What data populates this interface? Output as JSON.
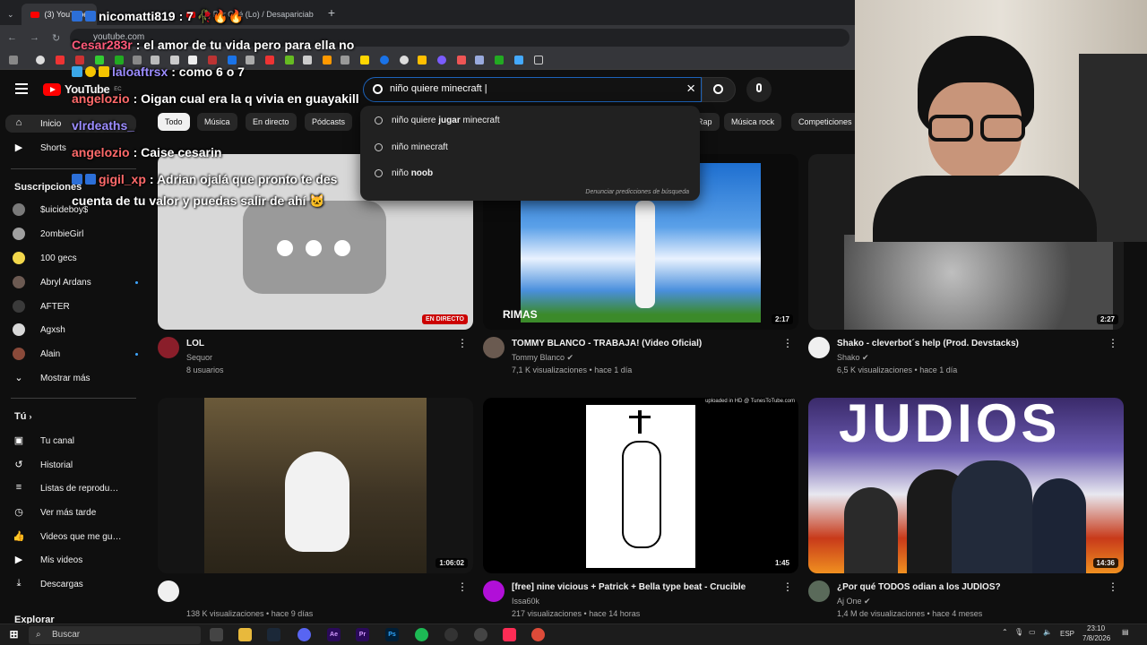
{
  "browser": {
    "tabs": [
      {
        "title": "(3) YouTube"
      },
      {
        "title": "(3) Por Qué (Lo) / Desapariciab"
      }
    ],
    "new_tab": "+",
    "url": "youtube.com"
  },
  "youtube": {
    "logo": "YouTube",
    "logo_region": "EC",
    "search_value": "niño quiere minecraft |",
    "clear_icon": "×",
    "suggestions": [
      {
        "prefix": "niño quiere ",
        "bold": "jugar",
        "suffix": " minecraft"
      },
      {
        "prefix": "niño ",
        "bold": "",
        "suffix": "minecraft"
      },
      {
        "prefix": "niño ",
        "bold": "noob",
        "suffix": ""
      }
    ],
    "report_link": "Denunciar predicciones de búsqueda"
  },
  "chips": [
    "Todo",
    "Música",
    "En directo",
    "Pódcasts",
    "Rap",
    "Música rock",
    "Competiciones"
  ],
  "sidebar": {
    "main": [
      {
        "label": "Inicio",
        "icon": "home-icon"
      },
      {
        "label": "Shorts",
        "icon": "shorts-icon"
      }
    ],
    "subscriptions_title": "Suscripciones",
    "subscriptions": [
      {
        "label": "$uicideboy$",
        "color": "#7a7a7a",
        "dot": false
      },
      {
        "label": "2ombieGirl",
        "color": "#a0a0a0",
        "dot": false
      },
      {
        "label": "100 gecs",
        "color": "#f2d74b",
        "dot": false
      },
      {
        "label": "Abryl Ardans",
        "color": "#6c5a52",
        "dot": true
      },
      {
        "label": "AFTER",
        "color": "#3a3a3a",
        "dot": false
      },
      {
        "label": "Agxsh",
        "color": "#d8d8d8",
        "dot": false
      },
      {
        "label": "Alain",
        "color": "#8a4a3a",
        "dot": true
      }
    ],
    "show_more": "Mostrar más",
    "you_title": "Tú",
    "you_items": [
      {
        "label": "Tu canal",
        "icon": "channel-icon"
      },
      {
        "label": "Historial",
        "icon": "history-icon"
      },
      {
        "label": "Listas de reproducc...",
        "icon": "playlist-icon"
      },
      {
        "label": "Ver más tarde",
        "icon": "clock-icon"
      },
      {
        "label": "Videos que me gus...",
        "icon": "like-icon"
      },
      {
        "label": "Mis videos",
        "icon": "video-icon"
      },
      {
        "label": "Descargas",
        "icon": "download-icon"
      }
    ],
    "explore_title": "Explorar"
  },
  "videos": [
    {
      "title": "LOL",
      "channel": "Sequor",
      "stats": "8 usuarios",
      "badge": "EN DIRECTO",
      "avatar": "#8a1e2a",
      "verified": false
    },
    {
      "title": "TOMMY BLANCO - TRABAJA! (Video Oficial)",
      "channel": "Tommy Blanco",
      "stats": "7,1 K visualizaciones • hace 1 día",
      "badge": "2:17",
      "avatar": "#6a5a50",
      "verified": true,
      "overlay": "RIMAS"
    },
    {
      "title": "Shako - cleverbot´s help (Prod. Devstacks)",
      "channel": "Shako",
      "stats": "6,5 K visualizaciones • hace 1 día",
      "badge": "2:27",
      "avatar": "#f0f0f0",
      "verified": true
    },
    {
      "title": "",
      "channel": "",
      "stats": "138 K visualizaciones • hace 9 días",
      "badge": "1:06:02",
      "avatar": "#f0f0f0",
      "verified": false
    },
    {
      "title": "[free] nine vicious + Patrick + Bella type beat - Crucible",
      "channel": "Issa60k",
      "stats": "217 visualizaciones • hace 14 horas",
      "badge": "1:45",
      "avatar": "#b10fd8",
      "verified": false,
      "overlay": "uploaded in HD @ TunesToTube.com"
    },
    {
      "title": "¿Por qué TODOS odian a los JUDÍOS?",
      "channel": "Aj One",
      "stats": "1,4 M de visualizaciones • hace 4 meses",
      "badge": "14:36",
      "avatar": "#5a6a5a",
      "verified": true,
      "overlay": "JUDIOS"
    }
  ],
  "chat": [
    {
      "user": "nicomatti819",
      "text": ": 7 🥀🔥🔥",
      "color": "#ffffff"
    },
    {
      "user": "Cesar283r",
      "text": ": el amor de tu vida pero para ella no",
      "color": "#ff5a7a"
    },
    {
      "user": "laloaftrsx",
      "text": ": como 6 o 7",
      "color": "#9b8cff"
    },
    {
      "user": "angelozio",
      "text": ": Oigan cual era la q vivia en guayakill",
      "color": "#ff6a6a"
    },
    {
      "user": "vlrdeaths_",
      "text": "",
      "color": "#9b8cff"
    },
    {
      "user": "angelozio",
      "text": ": Caise cesarin",
      "color": "#ff6a6a"
    },
    {
      "user": "gigil_xp",
      "text": ": Adrian ojalá que pronto te des",
      "color": "#ff6a6a"
    },
    {
      "user": "",
      "text": "cuenta de tu valor y puedas salir de ahí 🐱",
      "color": "#ffffff"
    }
  ],
  "taskbar": {
    "search_label": "Buscar",
    "language": "ESP",
    "time": "23:10",
    "date": "7/8/2026"
  }
}
